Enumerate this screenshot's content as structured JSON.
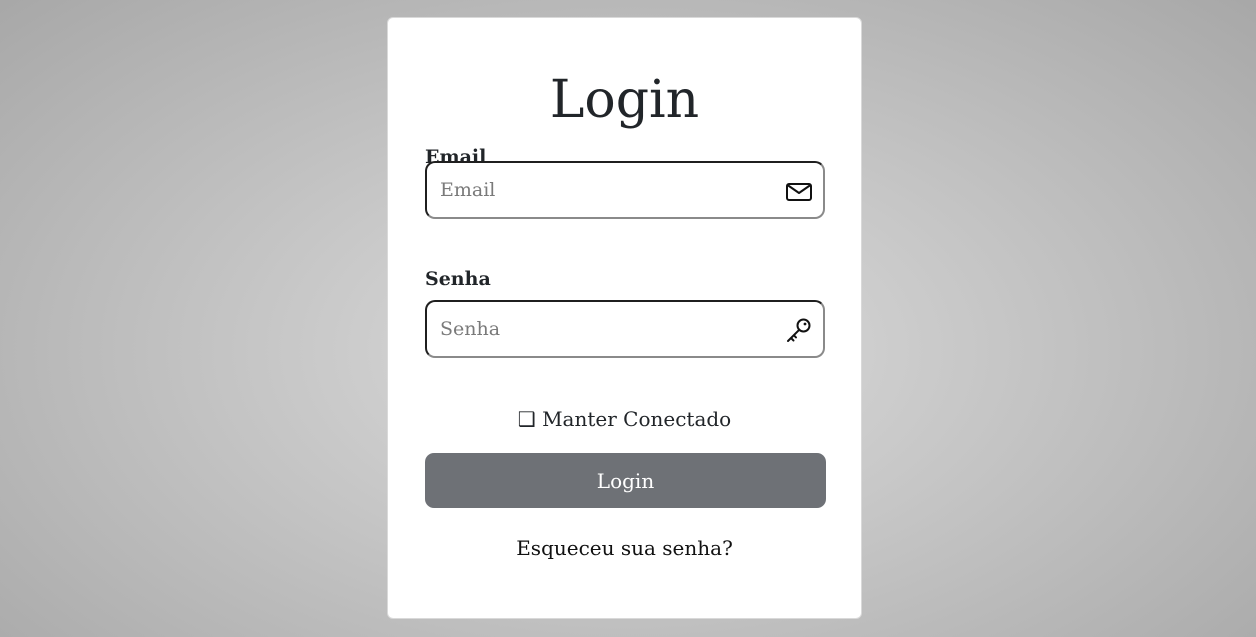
{
  "form": {
    "title": "Login",
    "email": {
      "label": "Email",
      "placeholder": "Email",
      "value": "",
      "icon": "envelope-icon"
    },
    "password": {
      "label": "Senha",
      "placeholder": "Senha",
      "value": "",
      "icon": "key-icon"
    },
    "remember": {
      "checkbox_glyph": "❑",
      "label": "Manter Conectado",
      "checked": false
    },
    "submit_label": "Login",
    "forgot_link": "Esqueceu sua senha?"
  },
  "colors": {
    "button_bg": "#6e7176",
    "button_text": "#ffffff",
    "card_bg": "#ffffff",
    "text": "#212529"
  }
}
